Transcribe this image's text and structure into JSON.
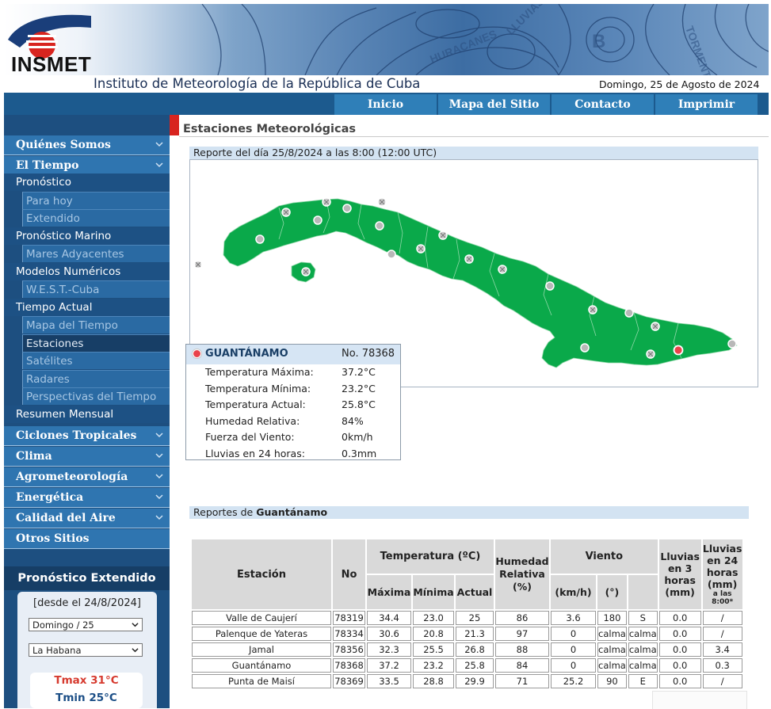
{
  "header": {
    "logo_text": "INSMET",
    "site_title": "Instituto de Meteorología de la República de Cuba",
    "date": "Domingo, 25 de Agosto de 2024",
    "banner_words": [
      "HURACANES",
      "LLUVIAS",
      "TORMENTA",
      "B"
    ]
  },
  "nav": [
    "Inicio",
    "Mapa del Sitio",
    "Contacto",
    "Imprimir"
  ],
  "sidebar": {
    "top_quienes": "Quiénes Somos",
    "top_tiempo": "El Tiempo",
    "pronostico": "Pronóstico",
    "para_hoy": "Para hoy",
    "extendido": "Extendido",
    "pron_marino": "Pronóstico Marino",
    "mares": "Mares Adyacentes",
    "modelos": "Modelos Numéricos",
    "west": "W.E.S.T.-Cuba",
    "tiempo_actual": "Tiempo Actual",
    "mapa_tiempo": "Mapa del Tiempo",
    "estaciones": "Estaciones",
    "satelites": "Satélites",
    "radares": "Radares",
    "perspectivas": "Perspectivas del Tiempo",
    "resumen": "Resumen Mensual",
    "ciclones": "Ciclones Tropicales",
    "clima": "Clima",
    "agro": "Agrometeorología",
    "energetica": "Energética",
    "calidad": "Calidad del Aire",
    "otros": "Otros Sitios"
  },
  "forecast": {
    "title": "Pronóstico Extendido",
    "since": "[desde el 24/8/2024]",
    "day_select": "Domingo / 25",
    "place_select": "La Habana",
    "tmax": "Tmax 31°C",
    "tmin": "Tmin 25°C"
  },
  "content": {
    "section_title": "Estaciones Meteorológicas",
    "report_heading": "Reporte del día 25/8/2024 a las 8:00  (12:00 UTC)",
    "reports_prefix": "Reportes de",
    "reports_province": "Guantánamo"
  },
  "map": {
    "land_color": "#0aa94a",
    "selected_station_color": "#e9424a"
  },
  "popup": {
    "station": "GUANTÁNAMO",
    "number": "No. 78368",
    "rows": [
      {
        "label": "Temperatura Máxima:",
        "value": "37.2°C"
      },
      {
        "label": "Temperatura Mínima:",
        "value": "23.2°C"
      },
      {
        "label": "Temperatura Actual:",
        "value": "25.8°C"
      },
      {
        "label": "Humedad Relativa:",
        "value": "84%"
      },
      {
        "label": "Fuerza del Viento:",
        "value": "0km/h"
      },
      {
        "label": "Lluvias en 24 horas:",
        "value": "0.3mm"
      }
    ]
  },
  "table": {
    "h_estacion": "Estación",
    "h_no": "No",
    "h_temp": "Temperatura (ºC)",
    "h_hum": "Humedad Relativa (%)",
    "h_viento": "Viento",
    "h_ll3": "Lluvias en 3 horas (mm)",
    "h_ll24": "Lluvias en 24 horas (mm)",
    "h_ll24_note": "a las 8:00*",
    "h_max": "Máxima",
    "h_min": "Mínima",
    "h_act": "Actual",
    "h_kmh": "(km/h)",
    "h_deg": "(°)",
    "rows": [
      [
        "Valle de Caujerí",
        "78319",
        "34.4",
        "23.0",
        "25",
        "86",
        "3.6",
        "180",
        "S",
        "0.0",
        "/"
      ],
      [
        "Palenque de Yateras",
        "78334",
        "30.6",
        "20.8",
        "21.3",
        "97",
        "0",
        "calma",
        "calma",
        "0.0",
        "/"
      ],
      [
        "Jamal",
        "78356",
        "32.3",
        "25.5",
        "26.8",
        "88",
        "0",
        "calma",
        "calma",
        "0.0",
        "3.4"
      ],
      [
        "Guantánamo",
        "78368",
        "37.2",
        "23.2",
        "25.8",
        "84",
        "0",
        "calma",
        "calma",
        "0.0",
        "0.3"
      ],
      [
        "Punta de Maisí",
        "78369",
        "33.5",
        "28.8",
        "29.9",
        "71",
        "25.2",
        "90",
        "E",
        "0.0",
        "/"
      ]
    ]
  }
}
